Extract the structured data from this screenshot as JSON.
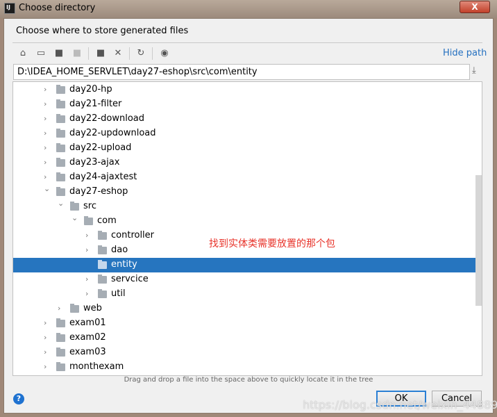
{
  "window": {
    "title": "Choose directory",
    "app_icon": "IJ",
    "close_label": "X"
  },
  "dialog": {
    "heading": "Choose where to store generated files",
    "toolbar": [
      "home-icon",
      "desktop-icon",
      "project-folder-icon",
      "module-folder-icon",
      "new-folder-icon",
      "delete-icon",
      "refresh-icon",
      "show-hidden-icon"
    ],
    "hide_path": "Hide path",
    "path_value": "D:\\IDEA_HOME_SERVLET\\day27-eshop\\src\\com\\entity",
    "tree": [
      {
        "label": "day20-hp",
        "level": 0,
        "expanded": false
      },
      {
        "label": "day21-filter",
        "level": 0,
        "expanded": false
      },
      {
        "label": "day22-download",
        "level": 0,
        "expanded": false
      },
      {
        "label": "day22-updownload",
        "level": 0,
        "expanded": false
      },
      {
        "label": "day22-upload",
        "level": 0,
        "expanded": false
      },
      {
        "label": "day23-ajax",
        "level": 0,
        "expanded": false
      },
      {
        "label": "day24-ajaxtest",
        "level": 0,
        "expanded": false
      },
      {
        "label": "day27-eshop",
        "level": 0,
        "expanded": true
      },
      {
        "label": "src",
        "level": 1,
        "expanded": true
      },
      {
        "label": "com",
        "level": 2,
        "expanded": true
      },
      {
        "label": "controller",
        "level": 3,
        "expanded": false
      },
      {
        "label": "dao",
        "level": 3,
        "expanded": false
      },
      {
        "label": "entity",
        "level": 3,
        "leaf": true,
        "selected": true
      },
      {
        "label": "servcice",
        "level": 3,
        "expanded": false
      },
      {
        "label": "util",
        "level": 3,
        "expanded": false
      },
      {
        "label": "web",
        "level": 1,
        "expanded": false
      },
      {
        "label": "exam01",
        "level": 0,
        "expanded": false
      },
      {
        "label": "exam02",
        "level": 0,
        "expanded": false
      },
      {
        "label": "exam03",
        "level": 0,
        "expanded": false
      },
      {
        "label": "monthexam",
        "level": 0,
        "expanded": false
      }
    ],
    "annotation": "找到实体类需要放置的那个包",
    "hint": "Drag and drop a file into the space above to quickly locate it in the tree",
    "ok": "OK",
    "cancel": "Cancel",
    "help": "?"
  },
  "watermark": "https://blog.csdn.net/weixin_44889894",
  "colors": {
    "selection": "#2675bf",
    "link": "#2470c0",
    "annotation": "#e8332a"
  }
}
